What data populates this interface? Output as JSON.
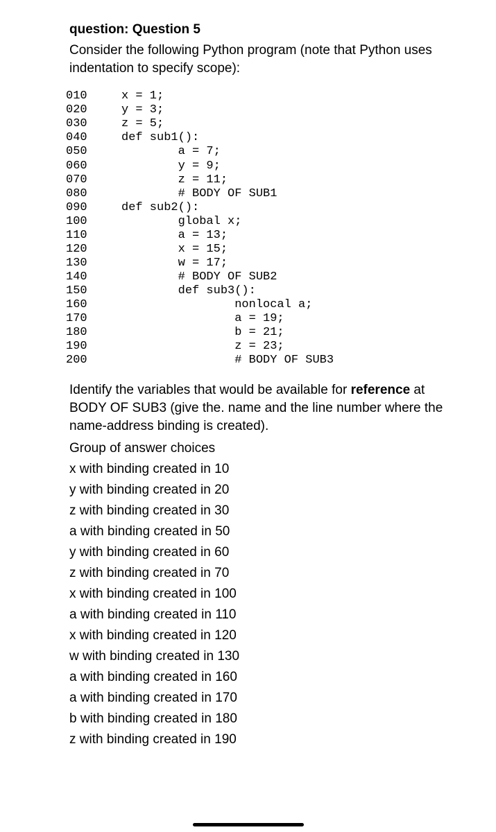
{
  "header": {
    "label": "question:",
    "title": "Question 5"
  },
  "intro": "Consider the following Python program (note that Python uses indentation to specify scope):",
  "code": [
    {
      "n": "010",
      "t": "x = 1;"
    },
    {
      "n": "020",
      "t": "y = 3;"
    },
    {
      "n": "030",
      "t": "z = 5;"
    },
    {
      "n": "040",
      "t": "def sub1():"
    },
    {
      "n": "050",
      "t": "        a = 7;"
    },
    {
      "n": "060",
      "t": "        y = 9;"
    },
    {
      "n": "070",
      "t": "        z = 11;"
    },
    {
      "n": "080",
      "t": "        # BODY OF SUB1"
    },
    {
      "n": "090",
      "t": "def sub2():"
    },
    {
      "n": "100",
      "t": "        global x;"
    },
    {
      "n": "110",
      "t": "        a = 13;"
    },
    {
      "n": "120",
      "t": "        x = 15;"
    },
    {
      "n": "130",
      "t": "        w = 17;"
    },
    {
      "n": "140",
      "t": "        # BODY OF SUB2"
    },
    {
      "n": "150",
      "t": "        def sub3():"
    },
    {
      "n": "160",
      "t": "                nonlocal a;"
    },
    {
      "n": "170",
      "t": "                a = 19;"
    },
    {
      "n": "180",
      "t": "                b = 21;"
    },
    {
      "n": "190",
      "t": "                z = 23;"
    },
    {
      "n": "200",
      "t": "                # BODY OF SUB3"
    }
  ],
  "prompt_parts": {
    "p1": "Identify the variables that would be available for ",
    "bold": "reference",
    "p2": " at BODY OF SUB3 (give the. name and the line number where the name-address binding is created)."
  },
  "choices_heading": "Group of answer choices",
  "choices": [
    "x with binding created in 10",
    "y with binding created in 20",
    "z with binding created in 30",
    "a with binding created in 50",
    "y with binding created in 60",
    "z with binding created in 70",
    "x with binding created in 100",
    "a with binding created in 110",
    "x with binding created in 120",
    "w with binding created in 130",
    "a with binding created in 160",
    "a with binding created in 170",
    "b with binding created in 180",
    "z with binding created in 190"
  ]
}
